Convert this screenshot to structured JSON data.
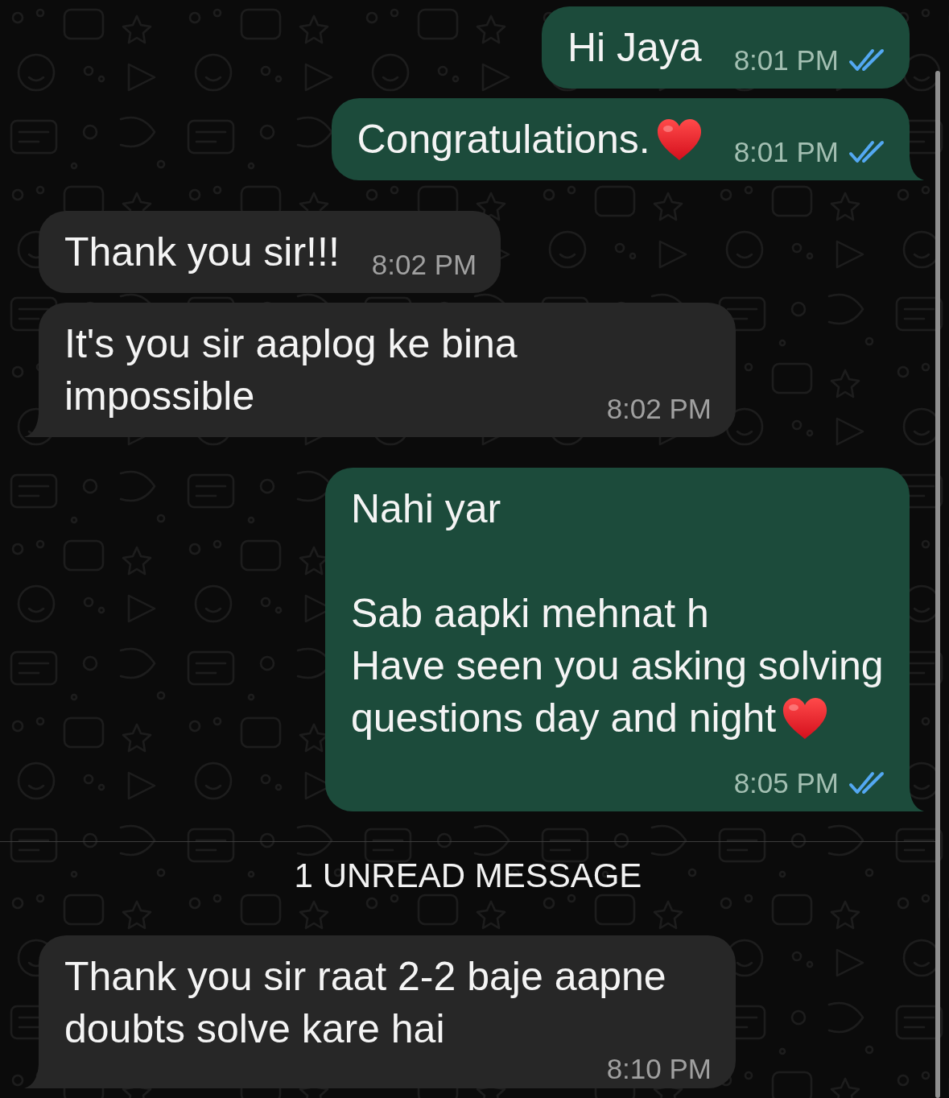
{
  "chat": [
    {
      "kind": "message",
      "outgoing": true,
      "text": "Hi Jaya",
      "time": "8:01 PM",
      "read": true,
      "tail": false
    },
    {
      "kind": "message",
      "outgoing": true,
      "text": "Congratulations.",
      "heart_emoji": true,
      "time": "8:01 PM",
      "read": true,
      "tail": true
    },
    {
      "kind": "message",
      "outgoing": false,
      "text": "Thank you sir!!!",
      "time": "8:02 PM",
      "tail": false
    },
    {
      "kind": "message",
      "outgoing": false,
      "text": "It's you sir aaplog ke bina impossible",
      "time": "8:02 PM",
      "tail": true
    },
    {
      "kind": "message",
      "outgoing": true,
      "text": "Nahi yar\n\nSab aapki mehnat h\nHave seen you asking solving questions day and night",
      "heart_emoji": true,
      "time": "8:05 PM",
      "read": true,
      "tail": true
    },
    {
      "kind": "unread_divider",
      "label": "1 UNREAD MESSAGE"
    },
    {
      "kind": "message",
      "outgoing": false,
      "text": "Thank you sir raat 2-2 baje aapne doubts solve kare hai",
      "time": "8:10 PM",
      "tail": true
    }
  ]
}
